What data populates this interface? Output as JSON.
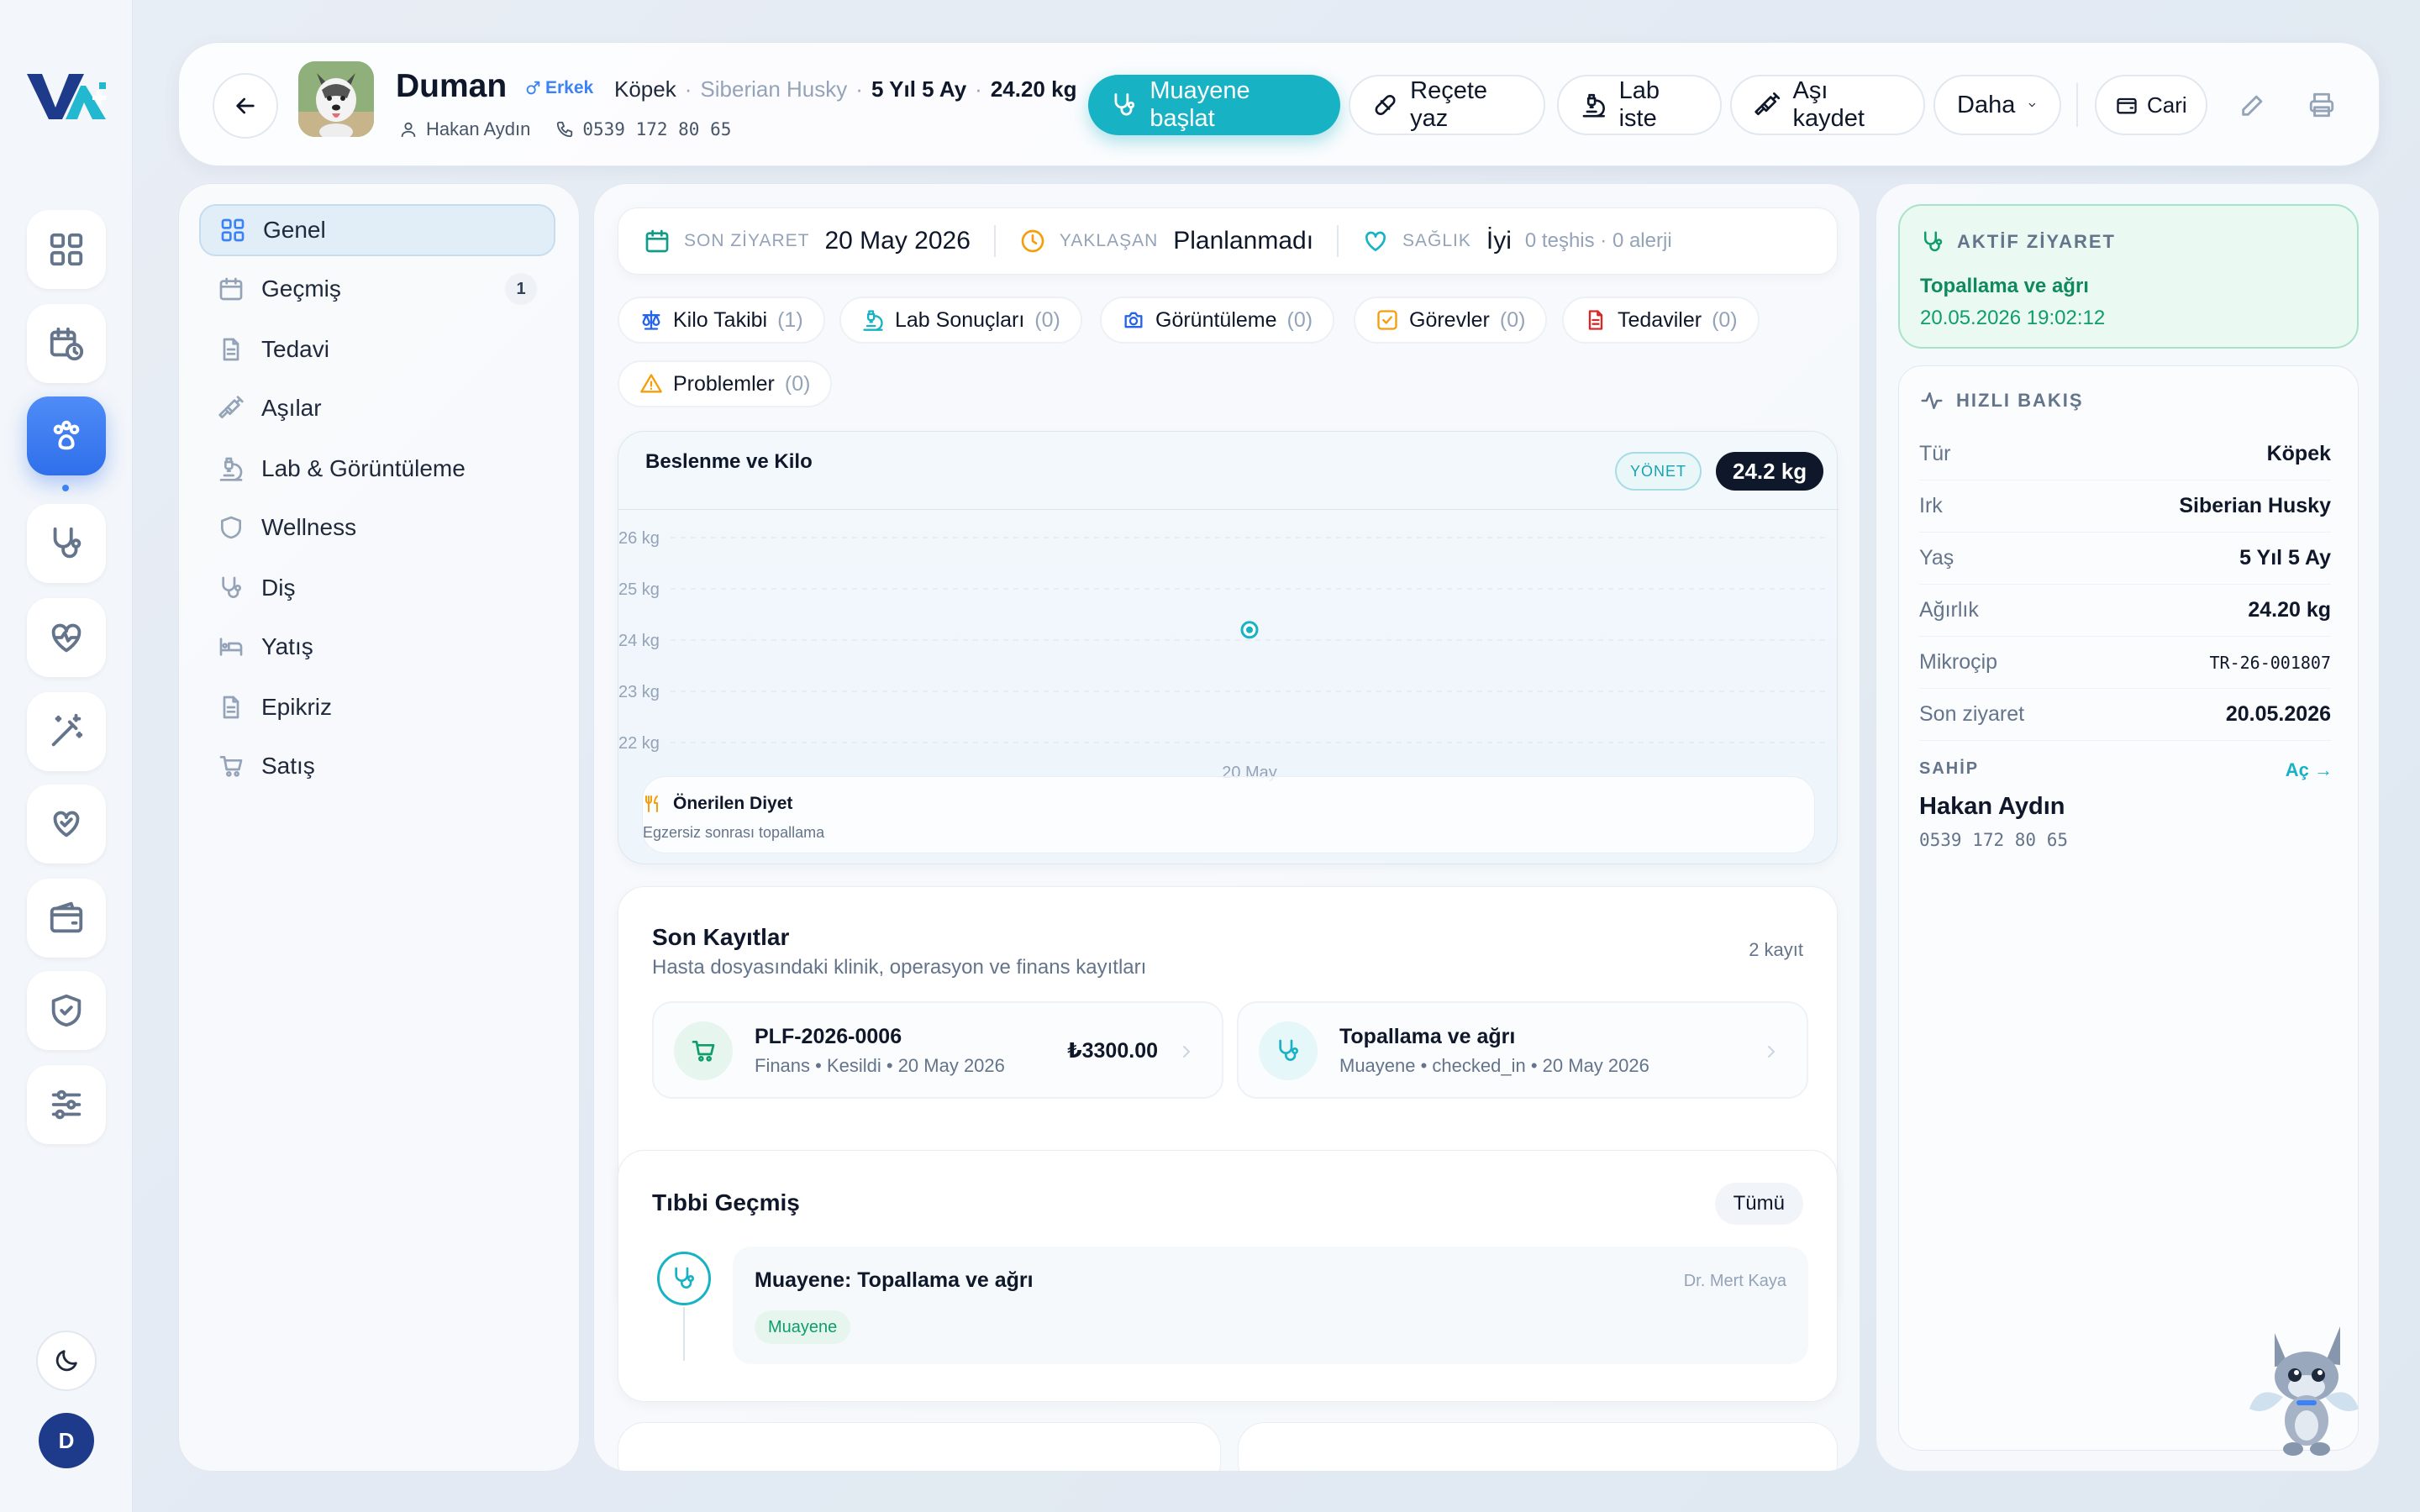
{
  "patient": {
    "name": "Duman",
    "gender": "Erkek",
    "species": "Köpek",
    "breed": "Siberian Husky",
    "age": "5 Yıl 5 Ay",
    "weight": "24.20 kg",
    "owner": "Hakan Aydın",
    "phone": "0539 172 80 65",
    "sep1": "·",
    "sep2": "·"
  },
  "actions": {
    "start_exam": "Muayene başlat",
    "prescription": "Reçete yaz",
    "lab": "Lab iste",
    "vaccine": "Aşı kaydet",
    "more": "Daha",
    "account": "Cari"
  },
  "nav": {
    "items": [
      {
        "label": "Genel",
        "icon": "grid-icon"
      },
      {
        "label": "Geçmiş",
        "icon": "calendar-icon",
        "badge": "1"
      },
      {
        "label": "Tedavi",
        "icon": "document-icon"
      },
      {
        "label": "Aşılar",
        "icon": "syringe-icon"
      },
      {
        "label": "Lab & Görüntüleme",
        "icon": "microscope-icon"
      },
      {
        "label": "Wellness",
        "icon": "shield-icon"
      },
      {
        "label": "Diş",
        "icon": "stethoscope-icon"
      },
      {
        "label": "Yatış",
        "icon": "bed-icon"
      },
      {
        "label": "Epikriz",
        "icon": "document-icon"
      },
      {
        "label": "Satış",
        "icon": "cart-icon"
      }
    ]
  },
  "summary": {
    "last_visit_label": "SON ZİYARET",
    "last_visit_value": "20 May 2026",
    "upcoming_label": "YAKLAŞAN",
    "upcoming_value": "Planlanmadı",
    "health_label": "SAĞLIK",
    "health_value": "İyi",
    "health_detail": "0 teşhis · 0 alerji"
  },
  "chips": [
    {
      "label": "Kilo Takibi",
      "count": "(1)"
    },
    {
      "label": "Lab Sonuçları",
      "count": "(0)"
    },
    {
      "label": "Görüntüleme",
      "count": "(0)"
    },
    {
      "label": "Görevler",
      "count": "(0)"
    },
    {
      "label": "Tedaviler",
      "count": "(0)"
    },
    {
      "label": "Problemler",
      "count": "(0)"
    }
  ],
  "weight_card": {
    "title": "Beslenme ve Kilo",
    "manage": "YÖNET",
    "current": "24.2 kg",
    "diet_title": "Önerilen Diyet",
    "diet_text": "Egzersiz sonrası topallama"
  },
  "chart_data": {
    "type": "scatter",
    "x": [
      "20 May"
    ],
    "y": [
      24.2
    ],
    "ytick_labels": [
      "26 kg",
      "25 kg",
      "24 kg",
      "23 kg",
      "22 kg"
    ],
    "ylim": [
      22,
      26
    ],
    "grid": true
  },
  "records": {
    "title": "Son Kayıtlar",
    "subtitle": "Hasta dosyasındaki klinik, operasyon ve finans kayıtları",
    "count": "2 kayıt",
    "items": [
      {
        "title": "PLF-2026-0006",
        "meta": "Finans • Kesildi • 20 May 2026",
        "amount": "₺3300.00"
      },
      {
        "title": "Topallama ve ağrı",
        "meta": "Muayene • checked_in • 20 May 2026"
      }
    ]
  },
  "history": {
    "title": "Tıbbi Geçmiş",
    "all": "Tümü",
    "entry_title": "Muayene: Topallama ve ağrı",
    "doctor": "Dr. Mert Kaya",
    "tag": "Muayene"
  },
  "active_visit": {
    "label": "AKTİF ZİYARET",
    "title": "Topallama ve ağrı",
    "datetime": "20.05.2026 19:02:12"
  },
  "quick": {
    "label": "HIZLI BAKIŞ",
    "rows": [
      {
        "k": "Tür",
        "v": "Köpek"
      },
      {
        "k": "Irk",
        "v": "Siberian Husky"
      },
      {
        "k": "Yaş",
        "v": "5 Yıl 5 Ay"
      },
      {
        "k": "Ağırlık",
        "v": "24.20 kg"
      },
      {
        "k": "Mikroçip",
        "v": "TR-26-001807"
      },
      {
        "k": "Son ziyaret",
        "v": "20.05.2026"
      }
    ],
    "owner_label": "SAHİP",
    "owner_open": "Aç →",
    "owner_name": "Hakan Aydın",
    "owner_phone": "0539 172 80 65"
  },
  "user": {
    "initial": "D"
  },
  "colors": {
    "accent": "#17b3c4",
    "primary": "#2f6fea",
    "success": "#0f9d68",
    "dark": "#0f172a"
  }
}
